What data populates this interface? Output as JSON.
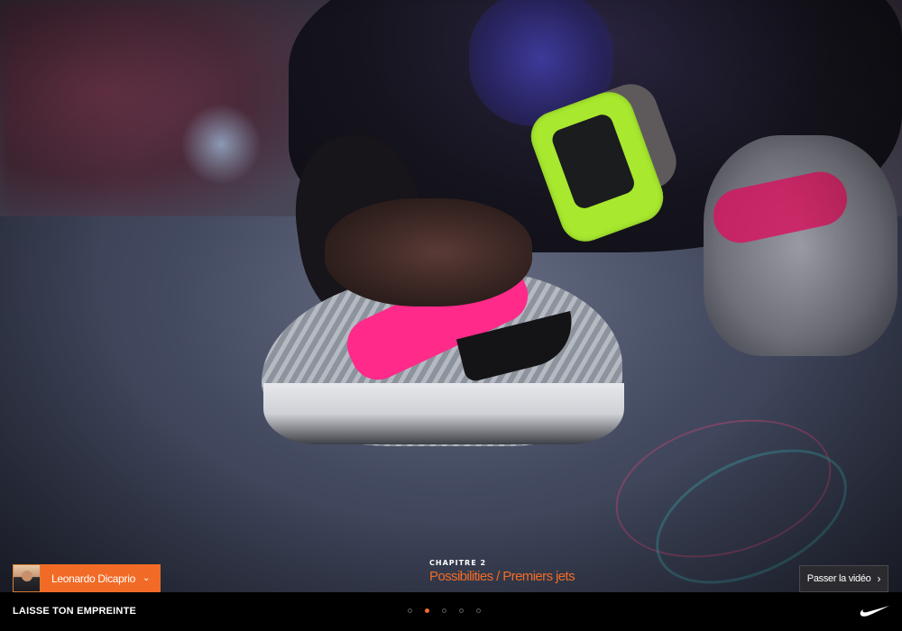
{
  "profile": {
    "name": "Leonardo Dicaprio",
    "chevron_icon": "chevron-down-icon",
    "accent": "#f26b26"
  },
  "chapter": {
    "kicker": "CHAPITRE 2",
    "title": "Possibilities / Premiers jets"
  },
  "skip": {
    "label": "Passer la vidéo",
    "icon": "chevron-right-icon"
  },
  "footer": {
    "brand_text": "LAISSE TON EMPREINTE",
    "logo_icon": "nike-swoosh-icon",
    "pager": {
      "total": 5,
      "active": 2
    }
  },
  "colors": {
    "accent": "#f26b26",
    "bar": "#000000",
    "button_bg": "#2b2a2f"
  }
}
